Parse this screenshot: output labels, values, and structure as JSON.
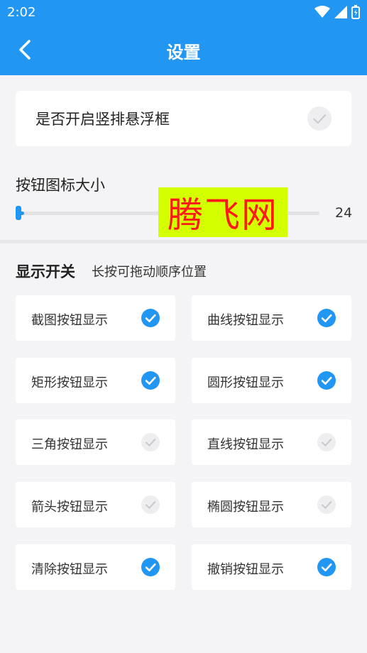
{
  "status_bar": {
    "time": "2:02"
  },
  "app_bar": {
    "title": "设置"
  },
  "floating_setting": {
    "label": "是否开启竖排悬浮框",
    "checked": false
  },
  "icon_size": {
    "label": "按钮图标大小",
    "value": "24",
    "fraction": 0.02
  },
  "watermark": {
    "text": "腾飞网"
  },
  "display_switches": {
    "title": "显示开关",
    "hint": "长按可拖动顺序位置",
    "items": [
      {
        "label": "截图按钮显示",
        "checked": true
      },
      {
        "label": "曲线按钮显示",
        "checked": true
      },
      {
        "label": "矩形按钮显示",
        "checked": true
      },
      {
        "label": "圆形按钮显示",
        "checked": true
      },
      {
        "label": "三角按钮显示",
        "checked": false
      },
      {
        "label": "直线按钮显示",
        "checked": false
      },
      {
        "label": "箭头按钮显示",
        "checked": false
      },
      {
        "label": "椭圆按钮显示",
        "checked": false
      },
      {
        "label": "清除按钮显示",
        "checked": true
      },
      {
        "label": "撤销按钮显示",
        "checked": true
      }
    ]
  },
  "colors": {
    "accent": "#2196f3",
    "background": "#f4f4f6",
    "unchecked": "#eeeef1",
    "watermark_bg": "#d4ff00",
    "watermark_text": "#ff1a1a"
  }
}
